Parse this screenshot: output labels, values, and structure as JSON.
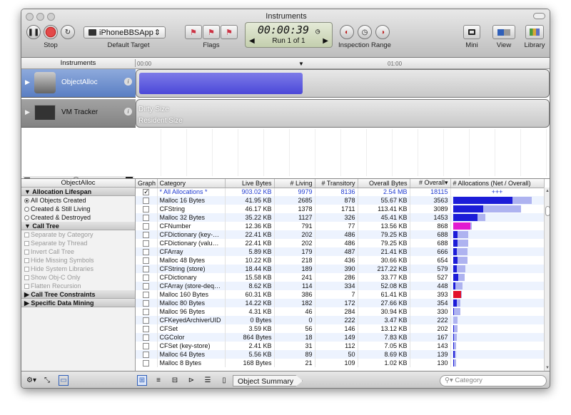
{
  "window": {
    "title": "Instruments"
  },
  "toolbar": {
    "stop_label": "Stop",
    "target_popup": "iPhoneBBSApp",
    "target_label": "Default Target",
    "flags_label": "Flags",
    "timer": "00:00:39",
    "run": "Run 1 of 1",
    "inspection_label": "Inspection Range",
    "mini_label": "Mini",
    "view_label": "View",
    "library_label": "Library"
  },
  "timeline": {
    "header": "Instruments",
    "tick0": "00:00",
    "tick1": "01:00"
  },
  "tracks": {
    "t1": "ObjectAlloc",
    "t2": "VM Tracker",
    "t2_line1": "Dirty Size",
    "t2_line2": "Resident Size"
  },
  "sidebar": {
    "header": "ObjectAlloc",
    "sec1": "Allocation Lifespan",
    "opt1": "All Objects Created",
    "opt2": "Created & Still Living",
    "opt3": "Created & Destroyed",
    "sec2": "Call Tree",
    "c1": "Separate by Category",
    "c2": "Separate by Thread",
    "c3": "Invert Call Tree",
    "c4": "Hide Missing Symbols",
    "c5": "Hide System Libraries",
    "c6": "Show Obj-C Only",
    "c7": "Flatten Recursion",
    "sec3": "Call Tree Constraints",
    "sec4": "Specific Data Mining"
  },
  "table": {
    "headers": [
      "Graph",
      "Category",
      "Live Bytes",
      "# Living",
      "# Transitory",
      "Overall Bytes",
      "# Overall▾",
      "# Allocations (Net / Overall)"
    ],
    "total": {
      "category": "* All Allocations *",
      "live": "903.02 KB",
      "living": "9979",
      "transitory": "8136",
      "overall_bytes": "2.54 MB",
      "overall": "18115",
      "alloc_label": "+++"
    },
    "rows": [
      {
        "category": "Malloc 16 Bytes",
        "live": "41.95 KB",
        "living": "2685",
        "transitory": "878",
        "overall_bytes": "55.67 KB",
        "overall": "3563",
        "color": "#1c1cd8"
      },
      {
        "category": "CFString",
        "live": "46.17 KB",
        "living": "1378",
        "transitory": "1711",
        "overall_bytes": "113.41 KB",
        "overall": "3089",
        "color": "#1c1cd8"
      },
      {
        "category": "Malloc 32 Bytes",
        "live": "35.22 KB",
        "living": "1127",
        "transitory": "326",
        "overall_bytes": "45.41 KB",
        "overall": "1453",
        "color": "#1c1cd8"
      },
      {
        "category": "CFNumber",
        "live": "12.36 KB",
        "living": "791",
        "transitory": "77",
        "overall_bytes": "13.56 KB",
        "overall": "868",
        "color": "#e21ad0"
      },
      {
        "category": "CFDictionary (key-store)",
        "live": "22.41 KB",
        "living": "202",
        "transitory": "486",
        "overall_bytes": "79.25 KB",
        "overall": "688",
        "color": "#1c1cd8"
      },
      {
        "category": "CFDictionary (value-store)",
        "live": "22.41 KB",
        "living": "202",
        "transitory": "486",
        "overall_bytes": "79.25 KB",
        "overall": "688",
        "color": "#1c1cd8"
      },
      {
        "category": "CFArray",
        "live": "5.89 KB",
        "living": "179",
        "transitory": "487",
        "overall_bytes": "21.41 KB",
        "overall": "666",
        "color": "#1c1cd8"
      },
      {
        "category": "Malloc 48 Bytes",
        "live": "10.22 KB",
        "living": "218",
        "transitory": "436",
        "overall_bytes": "30.66 KB",
        "overall": "654",
        "color": "#1c1cd8"
      },
      {
        "category": "CFString (store)",
        "live": "18.44 KB",
        "living": "189",
        "transitory": "390",
        "overall_bytes": "217.22 KB",
        "overall": "579",
        "color": "#1c1cd8"
      },
      {
        "category": "CFDictionary",
        "live": "15.58 KB",
        "living": "241",
        "transitory": "286",
        "overall_bytes": "33.77 KB",
        "overall": "527",
        "color": "#1c1cd8"
      },
      {
        "category": "CFArray (store-deque)",
        "live": "8.62 KB",
        "living": "114",
        "transitory": "334",
        "overall_bytes": "52.08 KB",
        "overall": "448",
        "color": "#1c1cd8"
      },
      {
        "category": "Malloc 160 Bytes",
        "live": "60.31 KB",
        "living": "386",
        "transitory": "7",
        "overall_bytes": "61.41 KB",
        "overall": "393",
        "color": "#e2102a"
      },
      {
        "category": "Malloc 80 Bytes",
        "live": "14.22 KB",
        "living": "182",
        "transitory": "172",
        "overall_bytes": "27.66 KB",
        "overall": "354",
        "color": "#1c1cd8"
      },
      {
        "category": "Malloc 96 Bytes",
        "live": "4.31 KB",
        "living": "46",
        "transitory": "284",
        "overall_bytes": "30.94 KB",
        "overall": "330",
        "color": "#1c1cd8"
      },
      {
        "category": "CFKeyedArchiverUID",
        "live": "0 Bytes",
        "living": "0",
        "transitory": "222",
        "overall_bytes": "3.47 KB",
        "overall": "222",
        "color": "#1c1cd8"
      },
      {
        "category": "CFSet",
        "live": "3.59 KB",
        "living": "56",
        "transitory": "146",
        "overall_bytes": "13.12 KB",
        "overall": "202",
        "color": "#1c1cd8"
      },
      {
        "category": "CGColor",
        "live": "864 Bytes",
        "living": "18",
        "transitory": "149",
        "overall_bytes": "7.83 KB",
        "overall": "167",
        "color": "#1c1cd8"
      },
      {
        "category": "CFSet (key-store)",
        "live": "2.41 KB",
        "living": "31",
        "transitory": "112",
        "overall_bytes": "7.05 KB",
        "overall": "143",
        "color": "#1c1cd8"
      },
      {
        "category": "Malloc 64 Bytes",
        "live": "5.56 KB",
        "living": "89",
        "transitory": "50",
        "overall_bytes": "8.69 KB",
        "overall": "139",
        "color": "#1c1cd8"
      },
      {
        "category": "Malloc 8 Bytes",
        "live": "168 Bytes",
        "living": "21",
        "transitory": "109",
        "overall_bytes": "1.02 KB",
        "overall": "130",
        "color": "#1c1cd8"
      }
    ]
  },
  "bottom": {
    "summary": "Object Summary",
    "search_placeholder": "Category"
  }
}
